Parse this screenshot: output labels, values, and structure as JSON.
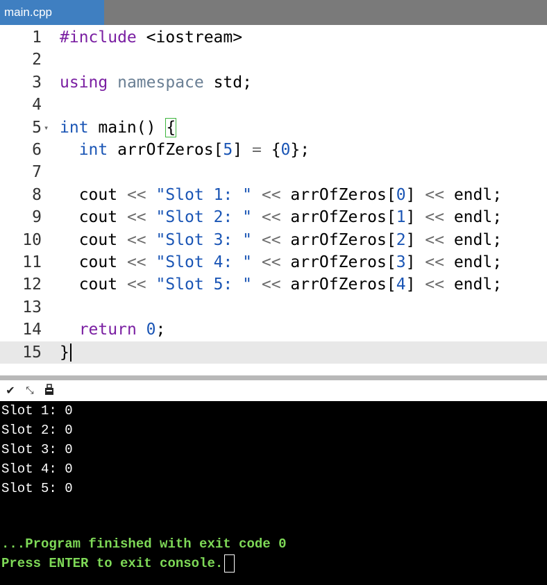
{
  "tab": {
    "title": "main.cpp"
  },
  "editor": {
    "lines": [
      {
        "num": "1",
        "parts": [
          {
            "c": "kw",
            "t": "#include"
          },
          {
            "c": "",
            "t": " <iostream>"
          }
        ]
      },
      {
        "num": "2",
        "parts": []
      },
      {
        "num": "3",
        "parts": [
          {
            "c": "kw",
            "t": "using"
          },
          {
            "c": "",
            "t": " "
          },
          {
            "c": "dimkw",
            "t": "namespace"
          },
          {
            "c": "",
            "t": " std;"
          }
        ]
      },
      {
        "num": "4",
        "parts": []
      },
      {
        "num": "5",
        "fold": "▾",
        "parts": [
          {
            "c": "type",
            "t": "int"
          },
          {
            "c": "",
            "t": " main() "
          },
          {
            "c": "bracehl",
            "t": "{"
          }
        ]
      },
      {
        "num": "6",
        "parts": [
          {
            "c": "",
            "t": "  "
          },
          {
            "c": "type",
            "t": "int"
          },
          {
            "c": "",
            "t": " arrOfZeros["
          },
          {
            "c": "num",
            "t": "5"
          },
          {
            "c": "",
            "t": "] "
          },
          {
            "c": "op",
            "t": "="
          },
          {
            "c": "",
            "t": " {"
          },
          {
            "c": "num",
            "t": "0"
          },
          {
            "c": "",
            "t": "};"
          }
        ]
      },
      {
        "num": "7",
        "parts": []
      },
      {
        "num": "8",
        "parts": [
          {
            "c": "",
            "t": "  cout "
          },
          {
            "c": "op",
            "t": "<<"
          },
          {
            "c": "",
            "t": " "
          },
          {
            "c": "str",
            "t": "\"Slot 1: \""
          },
          {
            "c": "",
            "t": " "
          },
          {
            "c": "op",
            "t": "<<"
          },
          {
            "c": "",
            "t": " arrOfZeros["
          },
          {
            "c": "num",
            "t": "0"
          },
          {
            "c": "",
            "t": "] "
          },
          {
            "c": "op",
            "t": "<<"
          },
          {
            "c": "",
            "t": " endl;"
          }
        ]
      },
      {
        "num": "9",
        "parts": [
          {
            "c": "",
            "t": "  cout "
          },
          {
            "c": "op",
            "t": "<<"
          },
          {
            "c": "",
            "t": " "
          },
          {
            "c": "str",
            "t": "\"Slot 2: \""
          },
          {
            "c": "",
            "t": " "
          },
          {
            "c": "op",
            "t": "<<"
          },
          {
            "c": "",
            "t": " arrOfZeros["
          },
          {
            "c": "num",
            "t": "1"
          },
          {
            "c": "",
            "t": "] "
          },
          {
            "c": "op",
            "t": "<<"
          },
          {
            "c": "",
            "t": " endl;"
          }
        ]
      },
      {
        "num": "10",
        "parts": [
          {
            "c": "",
            "t": "  cout "
          },
          {
            "c": "op",
            "t": "<<"
          },
          {
            "c": "",
            "t": " "
          },
          {
            "c": "str",
            "t": "\"Slot 3: \""
          },
          {
            "c": "",
            "t": " "
          },
          {
            "c": "op",
            "t": "<<"
          },
          {
            "c": "",
            "t": " arrOfZeros["
          },
          {
            "c": "num",
            "t": "2"
          },
          {
            "c": "",
            "t": "] "
          },
          {
            "c": "op",
            "t": "<<"
          },
          {
            "c": "",
            "t": " endl;"
          }
        ]
      },
      {
        "num": "11",
        "parts": [
          {
            "c": "",
            "t": "  cout "
          },
          {
            "c": "op",
            "t": "<<"
          },
          {
            "c": "",
            "t": " "
          },
          {
            "c": "str",
            "t": "\"Slot 4: \""
          },
          {
            "c": "",
            "t": " "
          },
          {
            "c": "op",
            "t": "<<"
          },
          {
            "c": "",
            "t": " arrOfZeros["
          },
          {
            "c": "num",
            "t": "3"
          },
          {
            "c": "",
            "t": "] "
          },
          {
            "c": "op",
            "t": "<<"
          },
          {
            "c": "",
            "t": " endl;"
          }
        ]
      },
      {
        "num": "12",
        "parts": [
          {
            "c": "",
            "t": "  cout "
          },
          {
            "c": "op",
            "t": "<<"
          },
          {
            "c": "",
            "t": " "
          },
          {
            "c": "str",
            "t": "\"Slot 5: \""
          },
          {
            "c": "",
            "t": " "
          },
          {
            "c": "op",
            "t": "<<"
          },
          {
            "c": "",
            "t": " arrOfZeros["
          },
          {
            "c": "num",
            "t": "4"
          },
          {
            "c": "",
            "t": "] "
          },
          {
            "c": "op",
            "t": "<<"
          },
          {
            "c": "",
            "t": " endl;"
          }
        ]
      },
      {
        "num": "13",
        "parts": []
      },
      {
        "num": "14",
        "parts": [
          {
            "c": "",
            "t": "  "
          },
          {
            "c": "kw",
            "t": "return"
          },
          {
            "c": "",
            "t": " "
          },
          {
            "c": "num",
            "t": "0"
          },
          {
            "c": "",
            "t": ";"
          }
        ]
      },
      {
        "num": "15",
        "active": true,
        "caret": true,
        "parts": [
          {
            "c": "",
            "t": "}"
          }
        ]
      }
    ]
  },
  "console_toolbar": {
    "icons": [
      "chevron-down-icon",
      "minimize-arrows-icon",
      "clear-console-icon"
    ]
  },
  "console": {
    "output": [
      "Slot 1: 0",
      "Slot 2: 0",
      "Slot 3: 0",
      "Slot 4: 0",
      "Slot 5: 0"
    ],
    "finished": "...Program finished with exit code 0",
    "prompt": "Press ENTER to exit console."
  }
}
